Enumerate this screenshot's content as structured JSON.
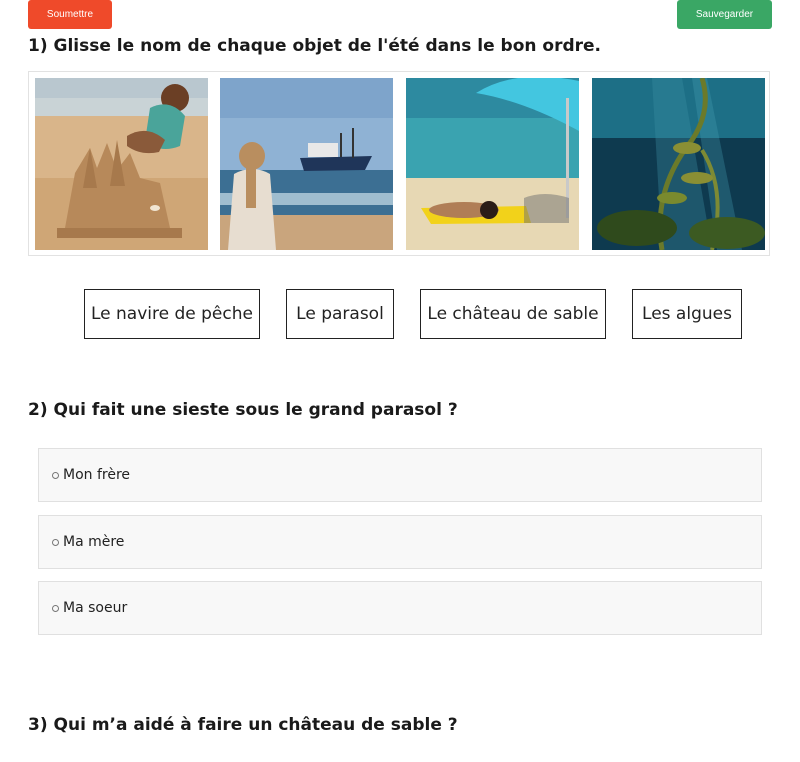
{
  "toolbar": {
    "submit_label": "Soumettre",
    "save_label": "Sauvegarder",
    "submit_color": "#ef4a2a",
    "save_color": "#3aa765"
  },
  "question1": {
    "title": "1) Glisse le nom de chaque objet de l'été dans le bon ordre.",
    "images": [
      {
        "subject": "sandcastle-child"
      },
      {
        "subject": "girl-fishing-boat"
      },
      {
        "subject": "parasol-beach"
      },
      {
        "subject": "underwater-seaweed"
      }
    ],
    "labels": [
      "Le navire de pêche",
      "Le parasol",
      "Le château de sable",
      "Les algues"
    ]
  },
  "question2": {
    "title": "2) Qui fait une sieste sous le grand parasol ?",
    "options": [
      "Mon frère",
      "Ma mère",
      "Ma soeur"
    ]
  },
  "question3": {
    "title": "3) Qui m’a aidé à faire un château de sable ?"
  }
}
